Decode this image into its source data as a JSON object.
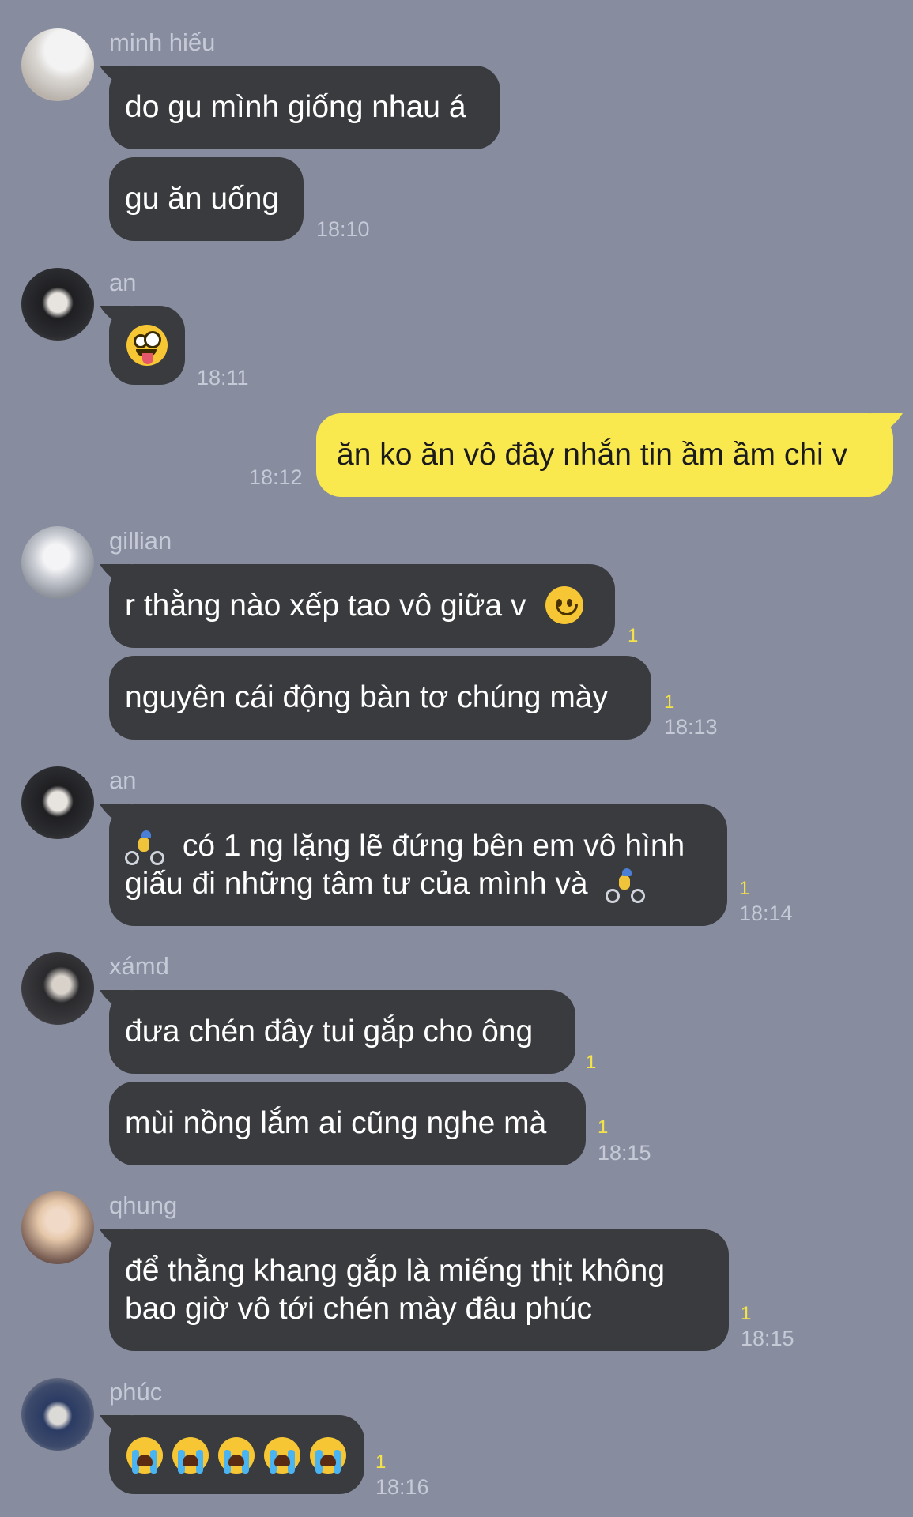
{
  "messages": {
    "m1": {
      "sender": "minh hiếu",
      "b1": "do gu mình giống nhau á",
      "b2": "gu ăn uống",
      "time": "18:10"
    },
    "m2": {
      "sender": "an",
      "time": "18:11"
    },
    "m3": {
      "text": "ăn ko ăn vô đây nhắn tin ầm ầm chi v",
      "time": "18:12"
    },
    "m4": {
      "sender": "gillian",
      "b1": "r thằng nào xếp tao vô giữa v",
      "b1_unread": "1",
      "b2": "nguyên cái động bàn tơ chúng mày",
      "b2_unread": "1",
      "time": "18:13"
    },
    "m5": {
      "sender": "an",
      "line1": "có 1 ng lặng lẽ đứng bên em vô hình",
      "line2": "giấu đi những tâm tư của mình và",
      "unread": "1",
      "time": "18:14"
    },
    "m6": {
      "sender": "xámd",
      "b1": "đưa chén đây tui gắp cho ông",
      "b1_unread": "1",
      "b2": "mùi nồng lắm ai cũng nghe mà",
      "b2_unread": "1",
      "time": "18:15"
    },
    "m7": {
      "sender": "qhung",
      "line1": "để thằng khang gắp là miếng thịt không",
      "line2": "bao giờ vô tới chén mày đâu phúc",
      "unread": "1",
      "time": "18:15"
    },
    "m8": {
      "sender": "phúc",
      "unread": "1",
      "time": "18:16"
    }
  },
  "icons": {
    "zany_face": "zany-face-emoji",
    "smile": "slightly-smiling-face-emoji",
    "bike": "person-biking-emoji",
    "cry": "loudly-crying-face-emoji"
  },
  "colors": {
    "background": "#878c9f",
    "bubble_other": "#3a3b3e",
    "bubble_mine": "#fae84f",
    "unread": "#f5e34a",
    "meta": "#c6cad7"
  }
}
